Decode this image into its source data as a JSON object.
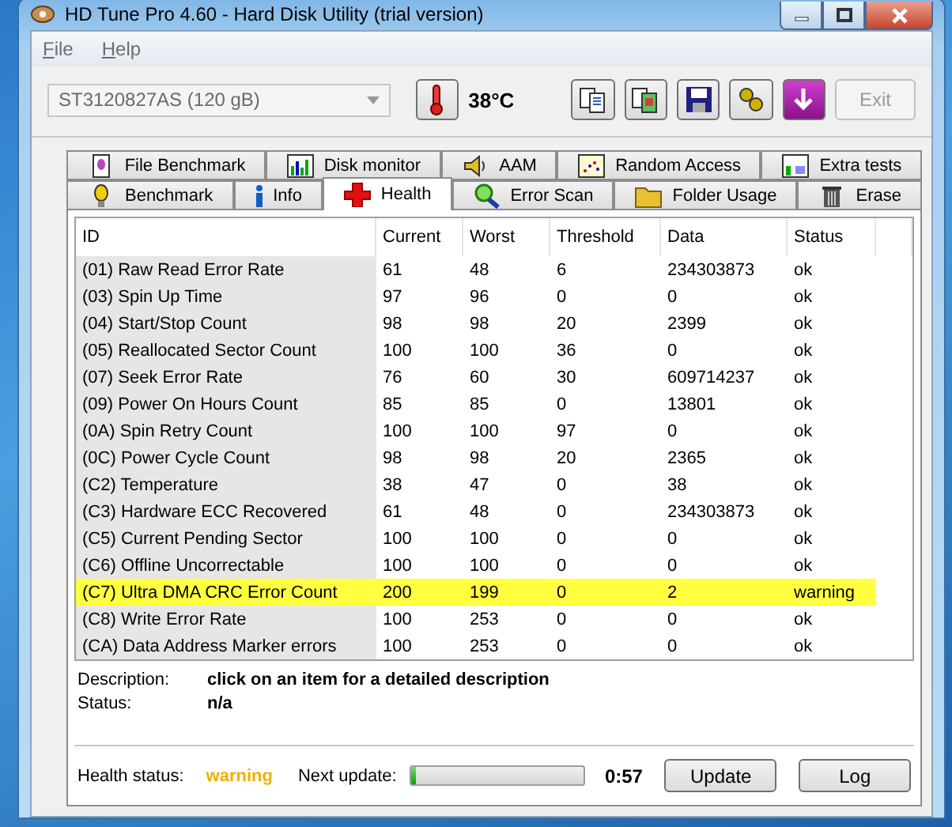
{
  "window": {
    "title": "HD Tune Pro 4.60 - Hard Disk Utility (trial version)"
  },
  "menu": [
    "File",
    "Help"
  ],
  "drive_select": {
    "value": "ST3120827AS (120 gB)",
    "disabled": true
  },
  "temperature": "38°C",
  "toolbar": [
    {
      "kind": "copy"
    },
    {
      "kind": "copy-screen"
    },
    {
      "kind": "save"
    },
    {
      "kind": "options"
    },
    {
      "kind": "download"
    }
  ],
  "exit_button": {
    "label": "Exit",
    "disabled": true
  },
  "tab_rows": [
    [
      {
        "label": "File Benchmark",
        "selected": false
      },
      {
        "label": "Disk monitor",
        "selected": false
      },
      {
        "label": "AAM",
        "selected": false
      },
      {
        "label": "Random Access",
        "selected": false
      },
      {
        "label": "Extra tests",
        "selected": false
      }
    ],
    [
      {
        "label": "Benchmark",
        "selected": false
      },
      {
        "label": "Info",
        "selected": false
      },
      {
        "label": "Health",
        "selected": true
      },
      {
        "label": "Error Scan",
        "selected": false
      },
      {
        "label": "Folder Usage",
        "selected": false
      },
      {
        "label": "Erase",
        "selected": false
      }
    ]
  ],
  "table": {
    "columns": [
      "ID",
      "Current",
      "Worst",
      "Threshold",
      "Data",
      "Status"
    ],
    "rows": [
      {
        "cells": [
          "(01) Raw Read Error Rate",
          "61",
          "48",
          "6",
          "234303873",
          "ok"
        ],
        "selected": false
      },
      {
        "cells": [
          "(03) Spin Up Time",
          "97",
          "96",
          "0",
          "0",
          "ok"
        ],
        "selected": false
      },
      {
        "cells": [
          "(04) Start/Stop Count",
          "98",
          "98",
          "20",
          "2399",
          "ok"
        ],
        "selected": false
      },
      {
        "cells": [
          "(05) Reallocated Sector Count",
          "100",
          "100",
          "36",
          "0",
          "ok"
        ],
        "selected": false
      },
      {
        "cells": [
          "(07) Seek Error Rate",
          "76",
          "60",
          "30",
          "609714237",
          "ok"
        ],
        "selected": false
      },
      {
        "cells": [
          "(09) Power On Hours Count",
          "85",
          "85",
          "0",
          "13801",
          "ok"
        ],
        "selected": false
      },
      {
        "cells": [
          "(0A) Spin Retry Count",
          "100",
          "100",
          "97",
          "0",
          "ok"
        ],
        "selected": false
      },
      {
        "cells": [
          "(0C) Power Cycle Count",
          "98",
          "98",
          "20",
          "2365",
          "ok"
        ],
        "selected": false
      },
      {
        "cells": [
          "(C2) Temperature",
          "38",
          "47",
          "0",
          "38",
          "ok"
        ],
        "selected": false
      },
      {
        "cells": [
          "(C3) Hardware ECC Recovered",
          "61",
          "48",
          "0",
          "234303873",
          "ok"
        ],
        "selected": false
      },
      {
        "cells": [
          "(C5) Current Pending Sector",
          "100",
          "100",
          "0",
          "0",
          "ok"
        ],
        "selected": false
      },
      {
        "cells": [
          "(C6) Offline Uncorrectable",
          "100",
          "100",
          "0",
          "0",
          "ok"
        ],
        "selected": false
      },
      {
        "cells": [
          "(C7) Ultra DMA CRC Error Count",
          "200",
          "199",
          "0",
          "2",
          "warning"
        ],
        "selected": true
      },
      {
        "cells": [
          "(C8) Write Error Rate",
          "100",
          "253",
          "0",
          "0",
          "ok"
        ],
        "selected": false
      },
      {
        "cells": [
          "(CA) Data Address Marker errors",
          "100",
          "253",
          "0",
          "0",
          "ok"
        ],
        "selected": false
      }
    ]
  },
  "details": [
    {
      "label": "Description:",
      "value": "click on an item for a detailed description"
    },
    {
      "label": "Status:",
      "value": "n/a"
    }
  ],
  "health_status": {
    "label": "Health status:",
    "value": "warning",
    "kind": "warning"
  },
  "next_update": {
    "label": "Next update:",
    "level": 0.03,
    "time": "0:57"
  },
  "buttons": [
    "Update",
    "Log"
  ]
}
